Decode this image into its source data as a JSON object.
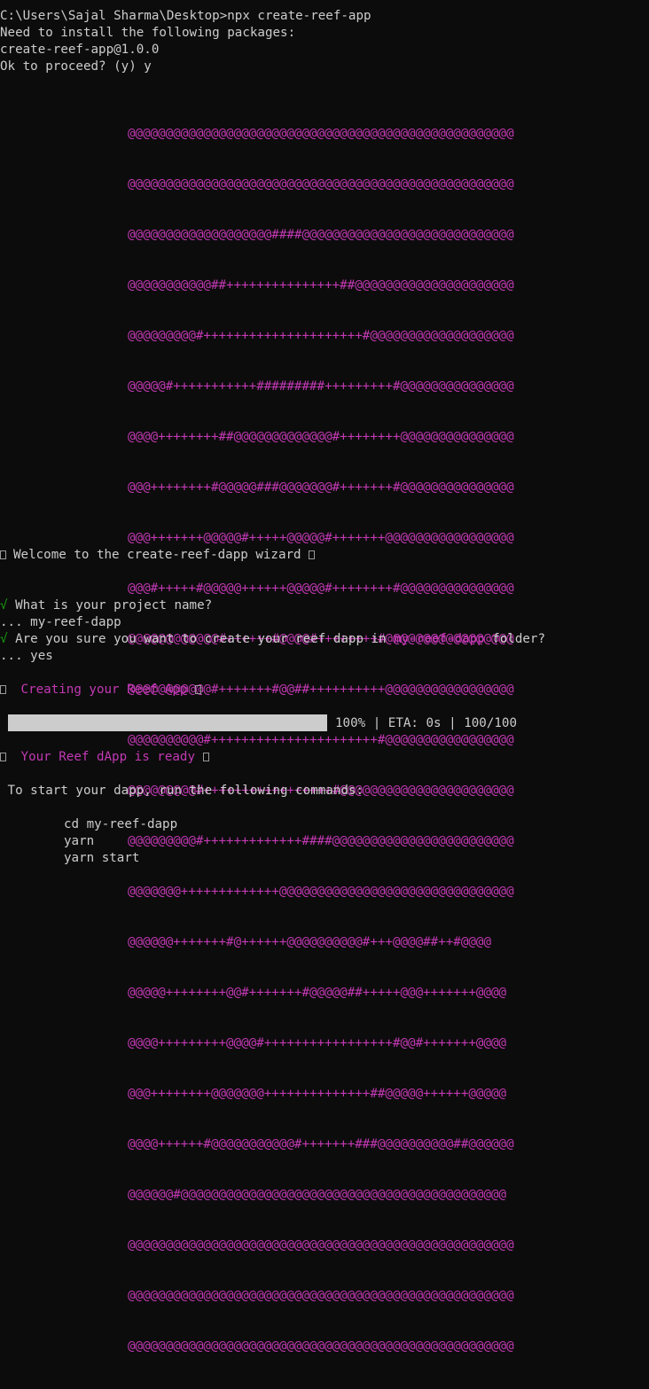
{
  "terminal": {
    "cmd_line": "C:\\Users\\Sajal Sharma\\Desktop>npx create-reef-app",
    "need_install": "Need to install the following packages:",
    "package": "create-reef-app@1.0.0",
    "proceed": "Ok to proceed? (y) y",
    "ascii_art": [
      "@@@@@@@@@@@@@@@@@@@@@@@@@@@@@@@@@@@@@@@@@@@@@@@@@@@",
      "@@@@@@@@@@@@@@@@@@@@@@@@@@@@@@@@@@@@@@@@@@@@@@@@@@@",
      "@@@@@@@@@@@@@@@@@@@####@@@@@@@@@@@@@@@@@@@@@@@@@@@@",
      "@@@@@@@@@@@##+++++++++++++++##@@@@@@@@@@@@@@@@@@@@@",
      "@@@@@@@@@#+++++++++++++++++++++#@@@@@@@@@@@@@@@@@@@",
      "@@@@@#+++++++++++#########+++++++++#@@@@@@@@@@@@@@@",
      "@@@@++++++++##@@@@@@@@@@@@@#++++++++@@@@@@@@@@@@@@@",
      "@@@++++++++#@@@@@###@@@@@@@#+++++++#@@@@@@@@@@@@@@@",
      "@@@+++++++@@@@@#+++++@@@@@#+++++++@@@@@@@@@@@@@@@@@",
      "@@@#+++++#@@@@@++++++@@@@@#++++++++#@@@@@@@@@@@@@@@",
      "@@@@@@@@@@@@#++++++#@@@@#++++++++#@@@@@@@@@@@@@@@@@",
      "@@@@@@@@@@@#+++++++#@@##++++++++++@@@@@@@@@@@@@@@@@",
      "@@@@@@@@@@#++++++++++++++++++++++#@@@@@@@@@@@@@@@@@",
      "@@@@@@@@@#+++++++++++++++++#@@@@@@@@@@@@@@@@@@@@@@@",
      "@@@@@@@@@#+++++++++++++####@@@@@@@@@@@@@@@@@@@@@@@@",
      "@@@@@@@+++++++++++++@@@@@@@@@@@@@@@@@@@@@@@@@@@@@@@",
      "@@@@@@+++++++#@++++++@@@@@@@@@@#+++@@@@##++#@@@@",
      "@@@@@++++++++@@#+++++++#@@@@@##+++++@@@+++++++@@@@",
      "@@@@+++++++++@@@@#+++++++++++++++++#@@#+++++++@@@@",
      "@@@++++++++@@@@@@@++++++++++++++##@@@@@++++++@@@@@",
      "@@@@++++++#@@@@@@@@@@@#+++++++###@@@@@@@@@@##@@@@@@",
      "@@@@@@#@@@@@@@@@@@@@@@@@@@@@@@@@@@@@@@@@@@@@@@@@@@",
      "@@@@@@@@@@@@@@@@@@@@@@@@@@@@@@@@@@@@@@@@@@@@@@@@@@@",
      "@@@@@@@@@@@@@@@@@@@@@@@@@@@@@@@@@@@@@@@@@@@@@@@@@@@",
      "@@@@@@@@@@@@@@@@@@@@@@@@@@@@@@@@@@@@@@@@@@@@@@@@@@@"
    ],
    "welcome": "Welcome to the create-reef-dapp wizard",
    "q1_check": "√",
    "q1": "What is your project name?",
    "a1": "... my-reef-dapp",
    "q2_check": "√",
    "q2_pre": "Are you sure you want to create your reef dapp in ",
    "q2_folder": "my-reef-dapp",
    "q2_post": " folder?",
    "a2": "... yes",
    "creating": "Creating your Reef App",
    "progress": {
      "percent": 100,
      "text": "100% | ETA: 0s | 100/100"
    },
    "ready": "Your Reef dApp is ready",
    "instructions": " To start your dapp, run the following commands:",
    "commands": [
      "cd my-reef-dapp",
      "yarn",
      "yarn start"
    ]
  },
  "colors": {
    "background": "#0c0c0c",
    "text": "#cccccc",
    "accent_magenta": "#c239b3",
    "success_green": "#13a10e"
  }
}
